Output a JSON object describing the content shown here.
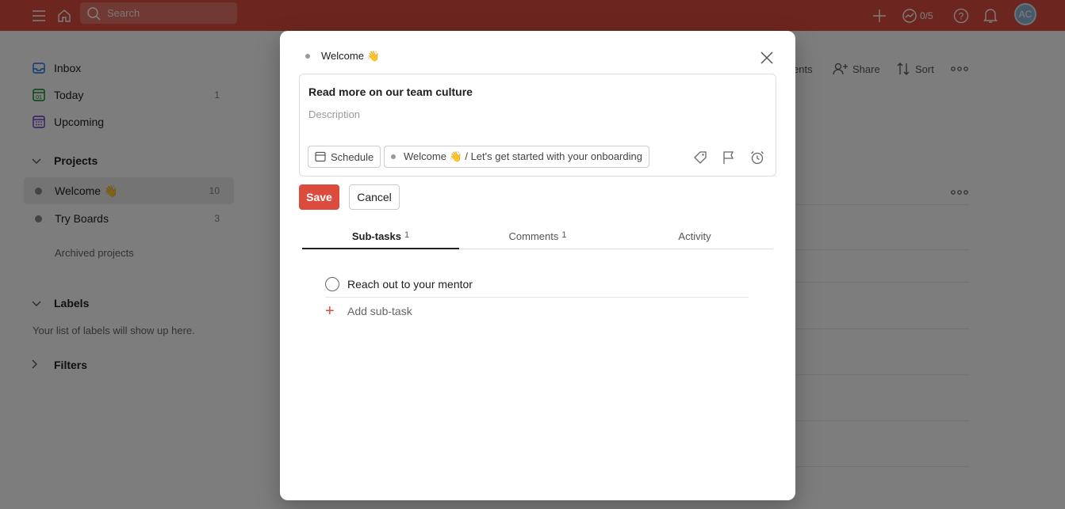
{
  "topbar": {
    "search_placeholder": "Search",
    "karma": "0/5",
    "avatar_initials": "AC",
    "icons": [
      "menu-icon",
      "home-icon",
      "search-icon",
      "add-icon",
      "productivity-icon",
      "help-icon",
      "bell-icon"
    ]
  },
  "sidebar": {
    "nav": [
      {
        "label": "Inbox",
        "count": ""
      },
      {
        "label": "Today",
        "count": "1"
      },
      {
        "label": "Upcoming",
        "count": ""
      }
    ],
    "projects_heading": "Projects",
    "projects": [
      {
        "label": "Welcome 👋",
        "count": "10"
      },
      {
        "label": "Try Boards",
        "count": "3"
      }
    ],
    "archived": "Archived projects",
    "labels_heading": "Labels",
    "labels_empty": "Your list of labels will show up here.",
    "filters_heading": "Filters"
  },
  "main": {
    "comments_partial": "ents",
    "share": "Share",
    "sort": "Sort"
  },
  "modal": {
    "breadcrumb": "Welcome 👋",
    "task_title": "Read more on our team culture",
    "description_placeholder": "Description",
    "schedule": "Schedule",
    "project_chip": "Welcome 👋 / Let's get started with your onboarding",
    "save": "Save",
    "cancel": "Cancel",
    "tabs": [
      {
        "label": "Sub-tasks",
        "count": "1"
      },
      {
        "label": "Comments",
        "count": "1"
      },
      {
        "label": "Activity",
        "count": ""
      }
    ],
    "subtasks": [
      "Reach out to your mentor"
    ],
    "add_subtask": "Add sub-task"
  },
  "colors": {
    "accent": "#db4c3f"
  }
}
